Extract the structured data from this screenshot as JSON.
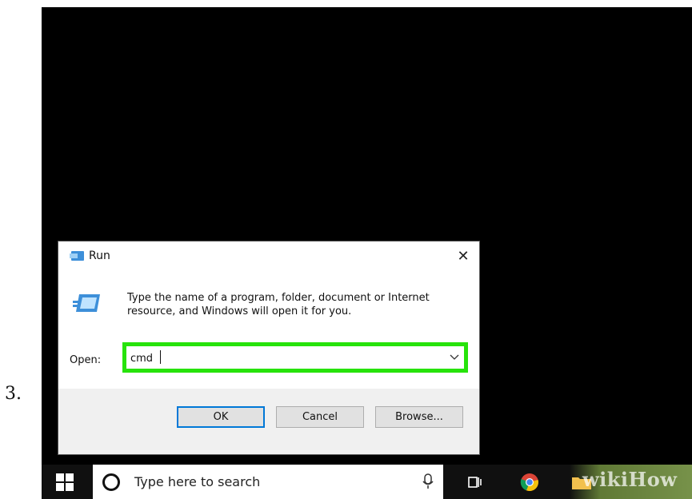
{
  "step": {
    "number": "3."
  },
  "run_dialog": {
    "title": "Run",
    "close_glyph": "✕",
    "description": "Type the name of a program, folder, document or Internet resource, and Windows will open it for you.",
    "open_label": "Open:",
    "open_value": "cmd",
    "buttons": {
      "ok": "OK",
      "cancel": "Cancel",
      "browse": "Browse..."
    },
    "highlight_color": "#27e30b"
  },
  "taskbar": {
    "search_placeholder": "Type here to search",
    "icons": [
      "windows-start-icon",
      "cortana-circle-icon",
      "microphone-icon",
      "task-view-icon",
      "chrome-icon",
      "file-explorer-icon"
    ]
  },
  "watermark": {
    "text": "wikiHow"
  }
}
